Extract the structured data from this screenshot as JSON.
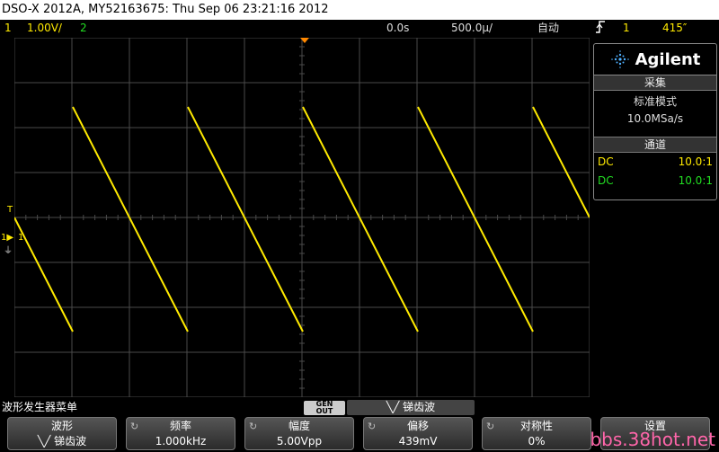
{
  "title_bar": {
    "text": "DSO-X 2012A, MY52163675: Thu Sep 06 23:21:16 2012"
  },
  "status_bar": {
    "ch1_num": "1",
    "ch1_scale": "1.00V/",
    "ch2_num": "2",
    "delay": "0.0s",
    "timebase": "500.0µ/",
    "trigger_mode": "自动",
    "trigger_icon": "trigger-edge-icon",
    "trigger_source": "1",
    "trigger_level": "415″"
  },
  "markers": {
    "trigger_level": "T",
    "ch1_ground": "1",
    "trigger_source_mark": "1"
  },
  "colors": {
    "ch1": "#ffea00",
    "ch2": "#22dd22",
    "grid": "#4a4a4a",
    "accent": "#ff8800"
  },
  "side_panel": {
    "brand": "Agilent",
    "acquire": {
      "title": "采集",
      "mode": "标准模式",
      "rate": "10.0MSa/s"
    },
    "channels": {
      "title": "通道",
      "rows": [
        {
          "coupling": "DC",
          "probe": "10.0:1"
        },
        {
          "coupling": "DC",
          "probe": "10.0:1"
        }
      ]
    }
  },
  "menu": {
    "title": "波形发生器菜单",
    "gen_out_top": "GEN",
    "gen_out_bottom": "OUT",
    "waveform_label": "锑齿波"
  },
  "softkeys": [
    {
      "label": "波形",
      "value": "锑齿波"
    },
    {
      "label": "频率",
      "value": "1.000kHz"
    },
    {
      "label": "幅度",
      "value": "5.00Vpp"
    },
    {
      "label": "偏移",
      "value": "439mV"
    },
    {
      "label": "对称性",
      "value": "0%"
    },
    {
      "label": "设置",
      "value": ""
    }
  ],
  "watermark": "bbs.38hot.net"
}
